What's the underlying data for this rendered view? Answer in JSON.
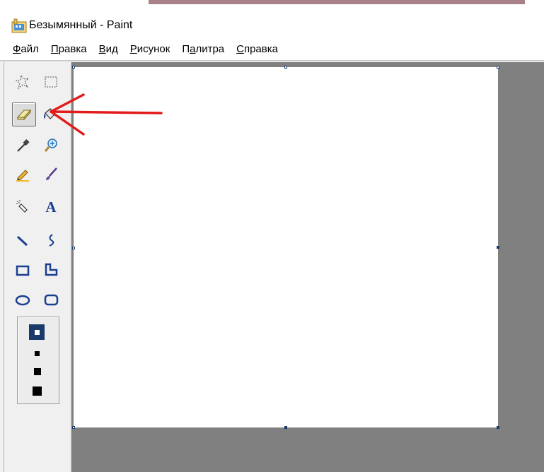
{
  "window": {
    "title": "Безымянный - Paint"
  },
  "menu": {
    "items": [
      {
        "underline": "Ф",
        "rest": "айл"
      },
      {
        "underline": "П",
        "rest": "равка"
      },
      {
        "underline": "В",
        "rest": "ид"
      },
      {
        "underline": "Р",
        "rest": "исунок"
      },
      {
        "pre": "П",
        "underline": "а",
        "rest": "литра"
      },
      {
        "underline": "С",
        "rest": "правка"
      }
    ]
  },
  "toolbox": {
    "selected_tool": "eraser",
    "tools": [
      "free-form-select-icon",
      "rectangle-select-icon",
      "eraser-icon",
      "fill-bucket-icon",
      "color-picker-icon",
      "magnifier-icon",
      "pencil-icon",
      "brush-icon",
      "airbrush-icon",
      "text-icon",
      "line-icon",
      "curve-icon",
      "rectangle-icon",
      "polygon-icon",
      "ellipse-icon",
      "rounded-rectangle-icon"
    ],
    "eraser_sizes": [
      "size-1",
      "size-2",
      "size-3",
      "size-4"
    ],
    "selected_size": "size-1"
  },
  "colors": {
    "workspace": "#808080",
    "canvas": "#ffffff",
    "annotation_arrow": "#e21b1b",
    "handle": "#1a3a6a"
  }
}
